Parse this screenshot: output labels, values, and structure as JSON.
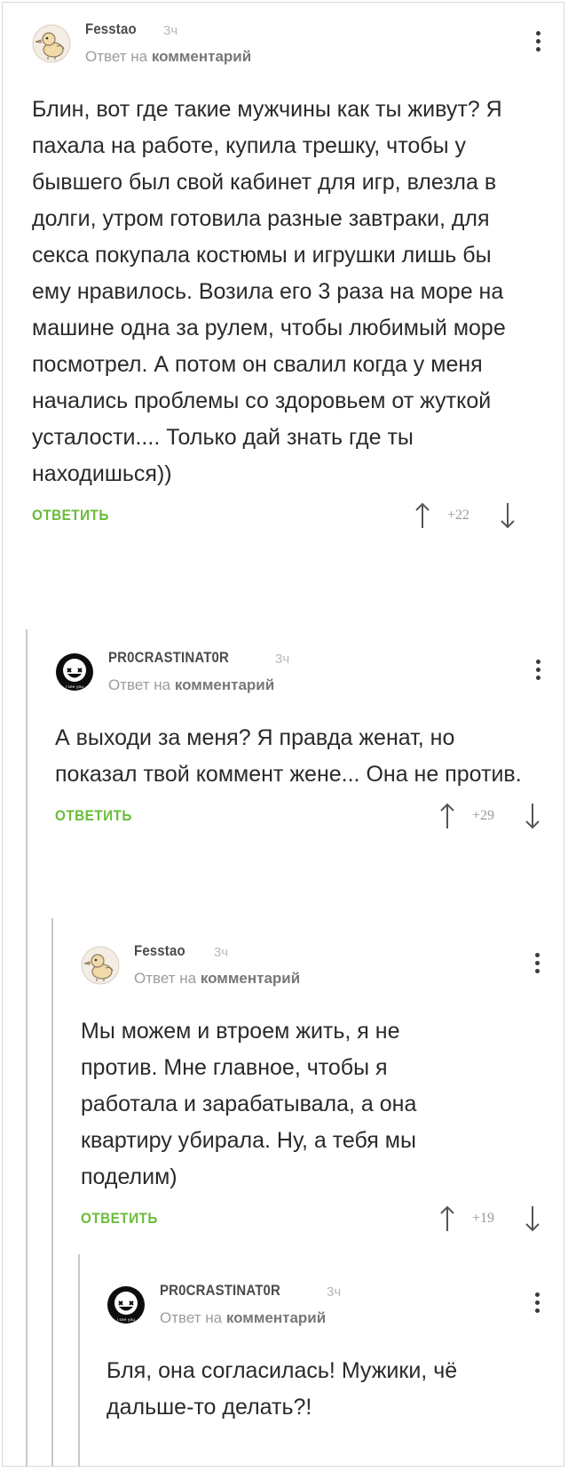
{
  "comments": [
    {
      "author": "Fesstao",
      "time": "3ч",
      "reply_prefix": "Ответ на",
      "reply_target": "комментарий",
      "text": "Блин, вот где такие мужчины как ты живут? Я пахала на работе, купила трешку, чтобы у бывшего был свой кабинет для игр, влезла в долги, утром готовила разные завтраки, для секса покупала костюмы и игрушки лишь бы ему нравилось. Возила его 3 раза на море на машине одна за рулем, чтобы любимый море посмотрел. А потом  он свалил когда у меня начались проблемы со здоровьем от жуткой усталости.... Только дай знать где ты находишься))",
      "reply_label": "ОТВЕТИТЬ",
      "score": "+22",
      "avatar_icon": "duck-avatar-icon"
    },
    {
      "author": "PR0CRASTINAT0R",
      "time": "3ч",
      "reply_prefix": "Ответ на",
      "reply_target": "комментарий",
      "text": "А выходи за меня? Я правда женат, но показал твой коммент жене... Она не против.",
      "reply_label": "ОТВЕТИТЬ",
      "score": "+29",
      "avatar_icon": "smiley-avatar-icon",
      "avatar_caption": "i see you"
    },
    {
      "author": "Fesstao",
      "time": "3ч",
      "reply_prefix": "Ответ на",
      "reply_target": "комментарий",
      "text": "Мы можем и втроем жить, я не против. Мне главное, чтобы я работала и зарабатывала, а она квартиру убирала. Ну, а тебя мы поделим)",
      "reply_label": "ОТВЕТИТЬ",
      "score": "+19",
      "avatar_icon": "duck-avatar-icon"
    },
    {
      "author": "PR0CRASTINAT0R",
      "time": "3ч",
      "reply_prefix": "Ответ на",
      "reply_target": "комментарий",
      "text": "Бля, она согласилась! Мужики, чё дальше-то делать?!",
      "avatar_icon": "smiley-avatar-icon",
      "avatar_caption": "i see you"
    }
  ],
  "colors": {
    "reply": "#6abc3a",
    "text": "#2a2a2a",
    "muted": "#9c9c9c",
    "thread_line": "#c9c9c9"
  }
}
